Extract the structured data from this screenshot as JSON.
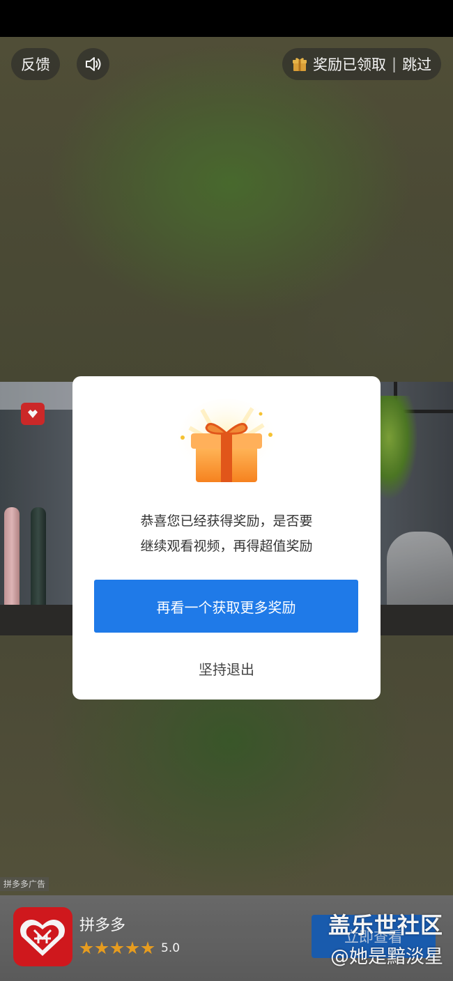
{
  "top_bar": {
    "feedback_label": "反馈",
    "sound_icon": "speaker-icon",
    "reward_status": "奖励已领取",
    "separator": "|",
    "skip_label": "跳过"
  },
  "ad": {
    "ad_label": "拼多多广告",
    "app_name": "拼多多",
    "rating_value": "5.0",
    "rating_stars": 5,
    "cta_label": "立即查看"
  },
  "dialog": {
    "message_line1": "恭喜您已经获得奖励，是否要",
    "message_line2": "继续观看视频，再得超值奖励",
    "primary_button": "再看一个获取更多奖励",
    "exit_link": "坚持退出"
  },
  "watermark": {
    "line1": "盖乐世社区",
    "line2": "@她是黯淡星"
  },
  "colors": {
    "primary_button": "#1f7ae8",
    "brand_red": "#d8191f",
    "star": "#f0a321",
    "gift_orange": "#f6911f"
  }
}
